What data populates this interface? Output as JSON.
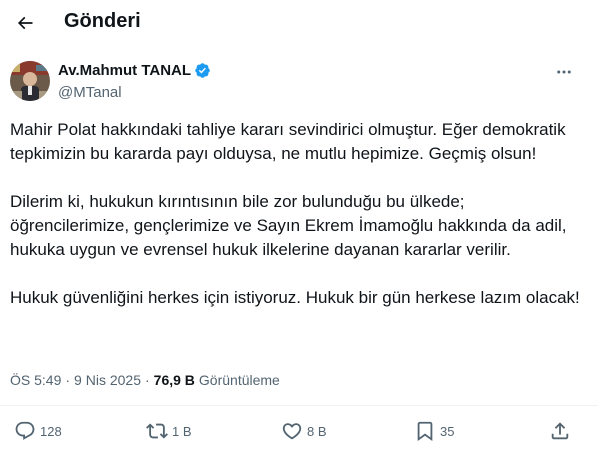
{
  "header": {
    "title": "Gönderi",
    "back_icon": "arrow-left-icon"
  },
  "author": {
    "name": "Av.Mahmut TANAL",
    "handle": "@MTanal",
    "verified_color": "#1d9bf0"
  },
  "tweet": {
    "paragraphs": [
      "Mahir Polat hakkındaki tahliye kararı sevindirici olmuştur. Eğer demokratik tepkimizin bu kararda payı olduysa, ne mutlu hepimize. Geçmiş olsun!",
      "Dilerim ki, hukukun kırıntısının bile zor bulunduğu bu ülkede; öğrencilerimize, gençlerimize ve Sayın Ekrem İmamoğlu hakkında da adil, hukuka uygun ve evrensel hukuk ilkelerine dayanan kararlar verilir.",
      "Hukuk güvenliğini herkes için istiyoruz. Hukuk bir gün herkese lazım olacak!"
    ]
  },
  "meta": {
    "time": "ÖS 5:49",
    "separator": "·",
    "date": "9 Nis 2025",
    "views_count": "76,9 B",
    "views_label": "Görüntüleme"
  },
  "actions": {
    "reply_count": "128",
    "retweet_count": "1 B",
    "like_count": "8 B",
    "bookmark_count": "35"
  },
  "colors": {
    "text": "#0f1419",
    "muted": "#536471",
    "border": "#eff3f4",
    "accent": "#1d9bf0"
  }
}
